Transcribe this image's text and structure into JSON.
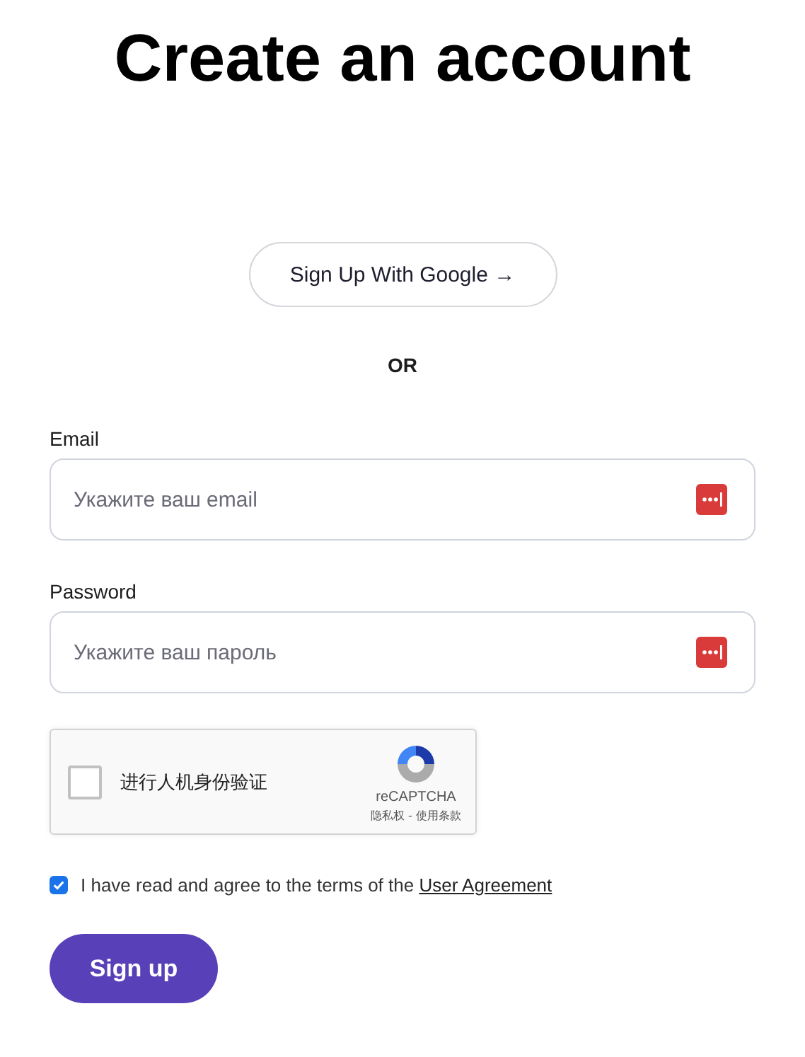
{
  "title": "Create an account",
  "google_button": "Sign Up With Google →",
  "divider": "OR",
  "fields": [
    {
      "label": "Email",
      "placeholder": "Укажите ваш email"
    },
    {
      "label": "Password",
      "placeholder": "Укажите ваш пароль"
    }
  ],
  "captcha": {
    "checked": false,
    "label": "进行人机身份验证",
    "brand": "reCAPTCHA",
    "links": "隐私权 - 使用条款"
  },
  "agreement": {
    "checked": true,
    "text": "I have read and agree to the terms of the",
    "link": "User Agreement"
  },
  "submit": "Sign up"
}
